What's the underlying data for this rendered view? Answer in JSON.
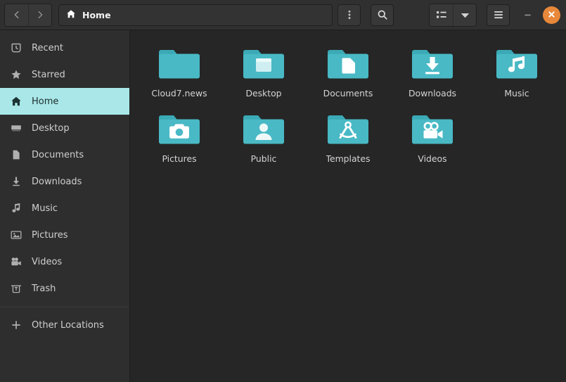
{
  "window": {
    "title": "Home",
    "accent_teal": "#44b8c4",
    "highlight_cyan": "#a9e7e8",
    "close_orange": "#e8883a",
    "header_bg": "#303030",
    "sidebar_bg": "#2e2e2e",
    "main_bg": "#262626"
  },
  "headerbar": {
    "back_label": "Back",
    "back_icon": "chevron-left-icon",
    "forward_label": "Forward",
    "forward_icon": "chevron-right-icon",
    "path": {
      "icon": "home-icon",
      "label": "Home"
    },
    "path_menu_label": "Location options",
    "path_menu_icon": "vertical-dots-icon",
    "search_label": "Search",
    "search_icon": "search-icon",
    "view_list_label": "List view",
    "view_list_icon": "list-view-icon",
    "view_dropdown_label": "View options",
    "view_dropdown_icon": "chevron-down-icon",
    "menu_label": "Main menu",
    "menu_icon": "hamburger-menu-icon",
    "minimize_label": "Minimize",
    "minimize_icon": "minimize-icon",
    "close_label": "Close",
    "close_icon": "close-icon"
  },
  "sidebar": {
    "items": [
      {
        "label": "Recent",
        "icon": "clock-icon",
        "active": false
      },
      {
        "label": "Starred",
        "icon": "star-icon",
        "active": false
      },
      {
        "label": "Home",
        "icon": "home-icon",
        "active": true
      },
      {
        "label": "Desktop",
        "icon": "desktop-icon",
        "active": false
      },
      {
        "label": "Documents",
        "icon": "document-icon",
        "active": false
      },
      {
        "label": "Downloads",
        "icon": "download-icon",
        "active": false
      },
      {
        "label": "Music",
        "icon": "music-icon",
        "active": false
      },
      {
        "label": "Pictures",
        "icon": "picture-icon",
        "active": false
      },
      {
        "label": "Videos",
        "icon": "video-icon",
        "active": false
      },
      {
        "label": "Trash",
        "icon": "trash-icon",
        "active": false
      }
    ],
    "other_locations": {
      "label": "Other Locations",
      "icon": "plus-icon"
    }
  },
  "files": [
    {
      "name": "Cloud7.news",
      "icon": "folder-plain-icon"
    },
    {
      "name": "Desktop",
      "icon": "folder-desktop-icon"
    },
    {
      "name": "Documents",
      "icon": "folder-documents-icon"
    },
    {
      "name": "Downloads",
      "icon": "folder-downloads-icon"
    },
    {
      "name": "Music",
      "icon": "folder-music-icon"
    },
    {
      "name": "Pictures",
      "icon": "folder-pictures-icon"
    },
    {
      "name": "Public",
      "icon": "folder-public-icon"
    },
    {
      "name": "Templates",
      "icon": "folder-templates-icon"
    },
    {
      "name": "Videos",
      "icon": "folder-videos-icon"
    }
  ]
}
